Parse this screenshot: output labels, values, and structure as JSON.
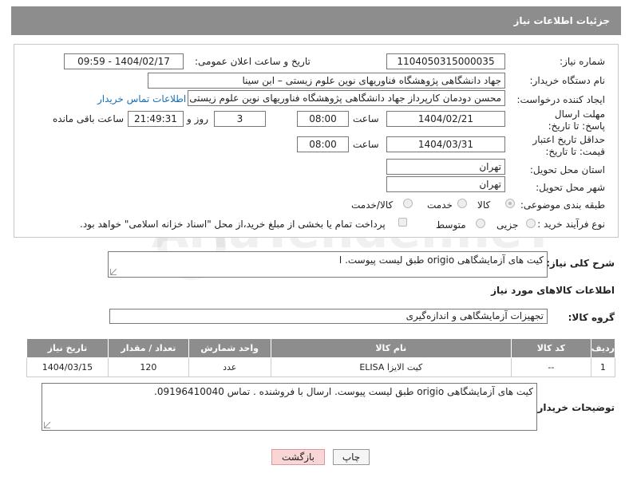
{
  "header": {
    "title": "جزئیات اطلاعات نیاز"
  },
  "fields": {
    "need_number_label": "شماره نیاز:",
    "need_number": "1104050315000035",
    "announce_label": "تاریخ و ساعت اعلان عمومی:",
    "announce_value": "1404/02/17 - 09:59",
    "buyer_org_label": "نام دستگاه خریدار:",
    "buyer_org": "جهاد دانشگاهی پژوهشگاه فناوریهای نوین علوم زیستی – ابن سینا",
    "requester_label": "ایجاد کننده درخواست:",
    "requester": "محسن دودمان کارپرداز جهاد دانشگاهی پژوهشگاه فناوریهای نوین علوم زیستی",
    "contact_link": "اطلاعات تماس خریدار",
    "deadline_label": "مهلت ارسال پاسخ: تا تاریخ:",
    "deadline_date": "1404/02/21",
    "time_label": "ساعت",
    "deadline_time": "08:00",
    "days_label": "روز و",
    "days": "3",
    "remaining": "21:49:31",
    "remaining_label": "ساعت باقی مانده",
    "min_price_label": "حداقل تاریخ اعتبار قیمت: تا تاریخ:",
    "min_price_date": "1404/03/31",
    "min_price_time": "08:00",
    "province_label": "استان محل تحویل:",
    "province": "تهران",
    "city_label": "شهر محل تحویل:",
    "city": "تهران",
    "category_label": "طبقه بندی موضوعی:",
    "category_options": [
      "کالا",
      "خدمت",
      "کالا/خدمت"
    ],
    "process_label": "نوع فرآیند خرید :",
    "process_options": [
      "جزیی",
      "متوسط"
    ],
    "payment_note": "پرداخت تمام یا بخشی از مبلغ خرید،از محل \"اسناد خزانه اسلامی\" خواهد بود."
  },
  "summary": {
    "label": "شرح کلی نیاز:",
    "value": "کیت های آزمایشگاهی origio طبق لیست پیوست. ا"
  },
  "goods_section": {
    "title": "اطلاعات کالاهای مورد نیاز",
    "group_label": "گروه کالا:",
    "group_value": "تجهیزات آزمایشگاهی و اندازه‌گیری"
  },
  "table": {
    "headers": [
      "ردیف",
      "کد کالا",
      "نام کالا",
      "واحد شمارش",
      "تعداد / مقدار",
      "تاریخ نیاز"
    ],
    "rows": [
      [
        "1",
        "--",
        "کیت الایزا ELISA",
        "عدد",
        "120",
        "1404/03/15"
      ]
    ]
  },
  "buyer_notes": {
    "label": "توضیحات خریدار:",
    "value": "کیت های آزمایشگاهی origio طبق لیست پیوست. ارسال با فروشنده . تماس 09196410040."
  },
  "buttons": {
    "print": "چاپ",
    "back": "بازگشت"
  },
  "watermark": "AriaTender.neT"
}
